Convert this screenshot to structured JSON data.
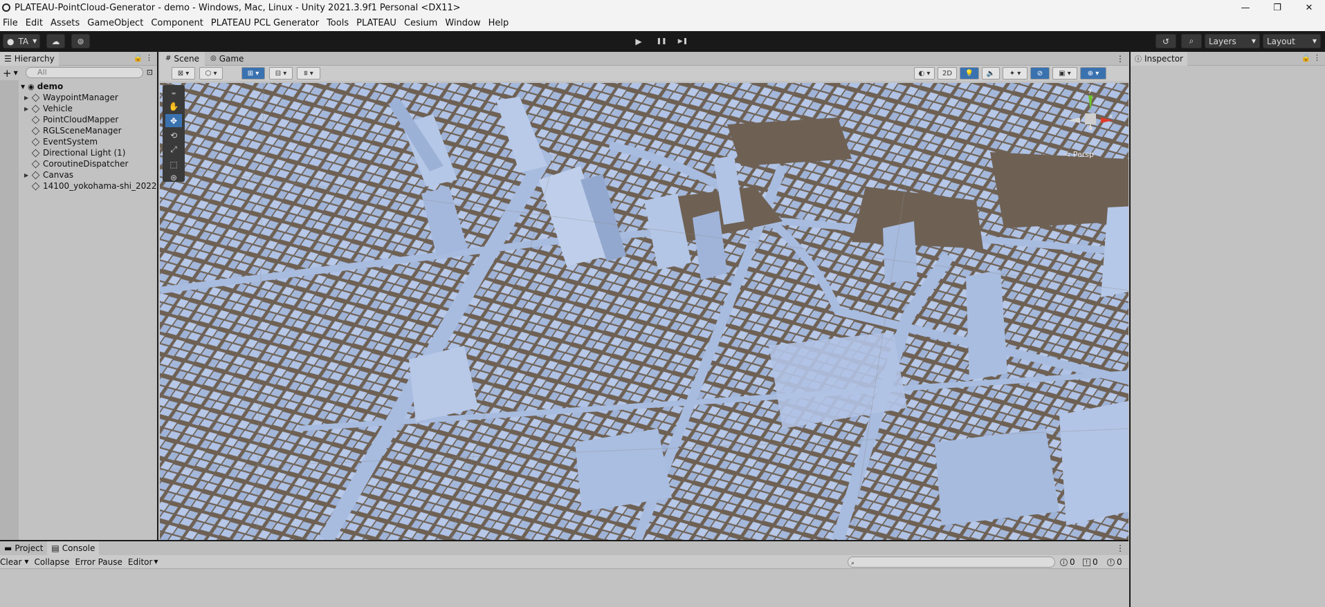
{
  "window": {
    "title": "PLATEAU-PointCloud-Generator - demo - Windows, Mac, Linux - Unity 2021.3.9f1 Personal <DX11>",
    "minimize": "—",
    "maximize": "❐",
    "close": "✕"
  },
  "menu": [
    "File",
    "Edit",
    "Assets",
    "GameObject",
    "Component",
    "PLATEAU PCL Generator",
    "Tools",
    "PLATEAU",
    "Cesium",
    "Window",
    "Help"
  ],
  "toolbar": {
    "account": "TA",
    "layers": "Layers",
    "layout": "Layout",
    "play": "▶",
    "pause": "❚❚",
    "step": "▶❚"
  },
  "hierarchy": {
    "tab": "Hierarchy",
    "search_placeholder": "All",
    "root": "demo",
    "items": [
      {
        "label": "WaypointManager",
        "expandable": true
      },
      {
        "label": "Vehicle",
        "expandable": true
      },
      {
        "label": "PointCloudMapper",
        "expandable": false
      },
      {
        "label": "RGLSceneManager",
        "expandable": false
      },
      {
        "label": "EventSystem",
        "expandable": false
      },
      {
        "label": "Directional Light (1)",
        "expandable": false
      },
      {
        "label": "CoroutineDispatcher",
        "expandable": false
      },
      {
        "label": "Canvas",
        "expandable": true
      },
      {
        "label": "14100_yokohama-shi_2022",
        "expandable": true
      }
    ]
  },
  "scene": {
    "tabs": [
      "Scene",
      "Game"
    ],
    "mode_2d": "2D",
    "persp": "< Persp",
    "gizmo_y": "y",
    "gizmo_x": "x"
  },
  "inspector": {
    "tab": "Inspector"
  },
  "console": {
    "tabs": [
      "Project",
      "Console"
    ],
    "buttons": [
      "Clear",
      "Collapse",
      "Error Pause",
      "Editor"
    ],
    "counts": {
      "log": "0",
      "warning": "0",
      "error": "0"
    }
  },
  "colors": {
    "building": "#a9bde0",
    "ground": "#6e6154",
    "editor_bg": "#c2c2c2",
    "toolbar": "#191919",
    "selection": "#3a72b0"
  }
}
